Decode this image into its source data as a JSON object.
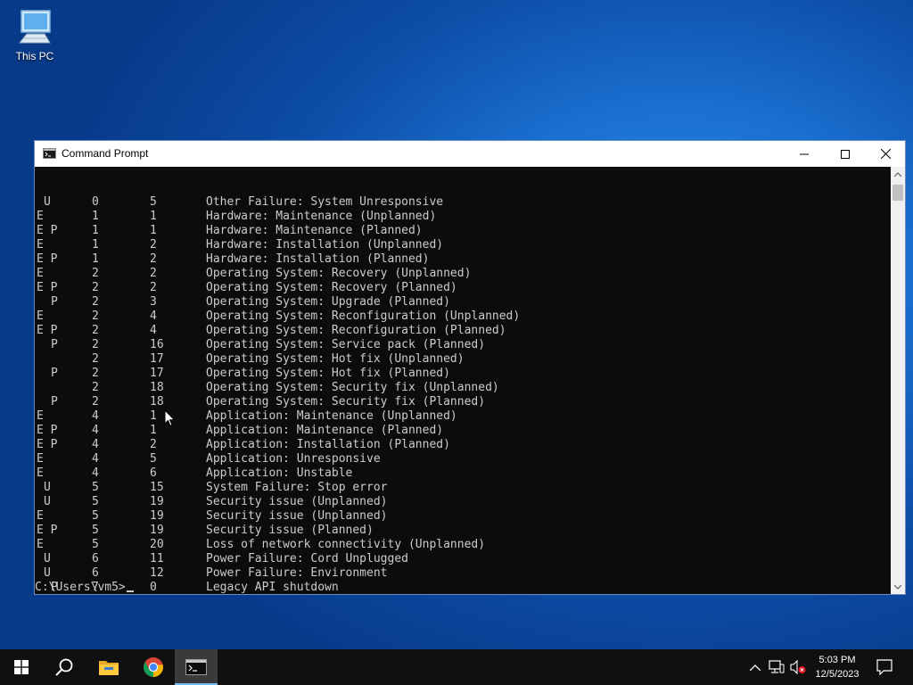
{
  "desktop": {
    "icon_label": "This PC"
  },
  "window": {
    "title": "Command Prompt",
    "rows": [
      [
        "U",
        "0",
        "5",
        "Other Failure: System Unresponsive"
      ],
      [
        "E",
        "1",
        "1",
        "Hardware: Maintenance (Unplanned)"
      ],
      [
        "E P",
        "1",
        "1",
        "Hardware: Maintenance (Planned)"
      ],
      [
        "E",
        "1",
        "2",
        "Hardware: Installation (Unplanned)"
      ],
      [
        "E P",
        "1",
        "2",
        "Hardware: Installation (Planned)"
      ],
      [
        "E",
        "2",
        "2",
        "Operating System: Recovery (Unplanned)"
      ],
      [
        "E P",
        "2",
        "2",
        "Operating System: Recovery (Planned)"
      ],
      [
        "P",
        "2",
        "3",
        "Operating System: Upgrade (Planned)"
      ],
      [
        "E",
        "2",
        "4",
        "Operating System: Reconfiguration (Unplanned)"
      ],
      [
        "E P",
        "2",
        "4",
        "Operating System: Reconfiguration (Planned)"
      ],
      [
        "P",
        "2",
        "16",
        "Operating System: Service pack (Planned)"
      ],
      [
        "",
        "2",
        "17",
        "Operating System: Hot fix (Unplanned)"
      ],
      [
        "P",
        "2",
        "17",
        "Operating System: Hot fix (Planned)"
      ],
      [
        "",
        "2",
        "18",
        "Operating System: Security fix (Unplanned)"
      ],
      [
        "P",
        "2",
        "18",
        "Operating System: Security fix (Planned)"
      ],
      [
        "E",
        "4",
        "1",
        "Application: Maintenance (Unplanned)"
      ],
      [
        "E P",
        "4",
        "1",
        "Application: Maintenance (Planned)"
      ],
      [
        "E P",
        "4",
        "2",
        "Application: Installation (Planned)"
      ],
      [
        "E",
        "4",
        "5",
        "Application: Unresponsive"
      ],
      [
        "E",
        "4",
        "6",
        "Application: Unstable"
      ],
      [
        "U",
        "5",
        "15",
        "System Failure: Stop error"
      ],
      [
        "U",
        "5",
        "19",
        "Security issue (Unplanned)"
      ],
      [
        "E",
        "5",
        "19",
        "Security issue (Unplanned)"
      ],
      [
        "E P",
        "5",
        "19",
        "Security issue (Planned)"
      ],
      [
        "E",
        "5",
        "20",
        "Loss of network connectivity (Unplanned)"
      ],
      [
        "U",
        "6",
        "11",
        "Power Failure: Cord Unplugged"
      ],
      [
        "U",
        "6",
        "12",
        "Power Failure: Environment"
      ],
      [
        "P",
        "7",
        "0",
        "Legacy API shutdown"
      ]
    ],
    "prompt": "C:\\Users\\vm5>"
  },
  "taskbar": {
    "time": "5:03 PM",
    "date": "12/5/2023"
  }
}
